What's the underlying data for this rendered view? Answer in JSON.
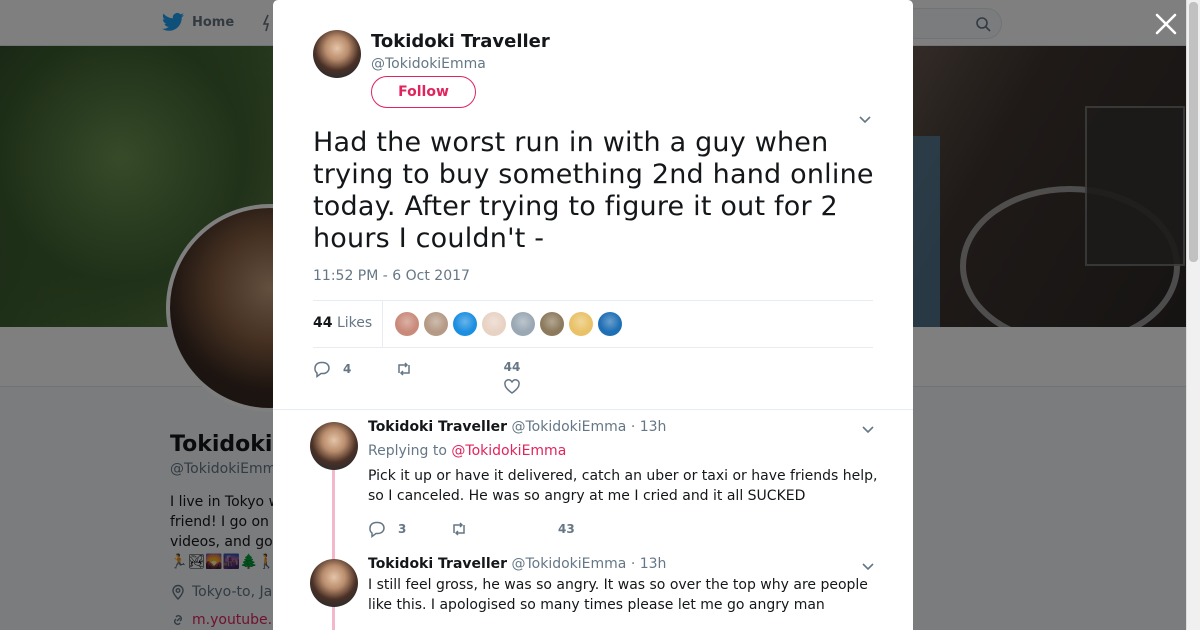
{
  "nav": {
    "home_label": "Home"
  },
  "profile": {
    "name": "Tokidoki",
    "handle": "@TokidokiEmm",
    "bio_lines": [
      "I live in Tokyo w",
      "friend! I go on",
      "videos, and go",
      "🏃🏞🌄🌆🌲🚶"
    ],
    "location": "Tokyo-to, Ja",
    "link": "m.youtube."
  },
  "tweet": {
    "author_name": "Tokidoki Traveller",
    "author_handle": "@TokidokiEmma",
    "follow_label": "Follow",
    "text": "Had the worst run in with a guy when trying to buy something 2nd hand online today. After trying to figure it out for 2 hours I couldn't -",
    "timestamp": "11:52 PM - 6 Oct 2017",
    "likes_count": "44",
    "likes_label": "Likes",
    "reply_count": "4",
    "like_count_action": "44",
    "likers": [
      "#c98a7a",
      "#b59a86",
      "#1d8fe0",
      "#e8d2c4",
      "#9aa8b4",
      "#8c7a5c",
      "#e9c267",
      "#1f6fb5"
    ]
  },
  "replies": [
    {
      "author_name": "Tokidoki Traveller",
      "author_handle": "@TokidokiEmma",
      "time": "· 13h",
      "replying_prefix": "Replying to",
      "replying_to": "@TokidokiEmma",
      "text": "Pick it up or have it delivered, catch an uber or taxi or have friends help, so I canceled. He was so angry at me I cried and it all SUCKED",
      "reply_count": "3",
      "like_count": "43"
    },
    {
      "author_name": "Tokidoki Traveller",
      "author_handle": "@TokidokiEmma",
      "time": "· 13h",
      "text": "I still feel gross, he was so angry. It was so over the top why are people like this. I apologised so many times please let me go angry man"
    }
  ],
  "colors": {
    "accent": "#e0245e",
    "text": "#14171a",
    "muted": "#657786",
    "thread": "#f3b8cb"
  }
}
